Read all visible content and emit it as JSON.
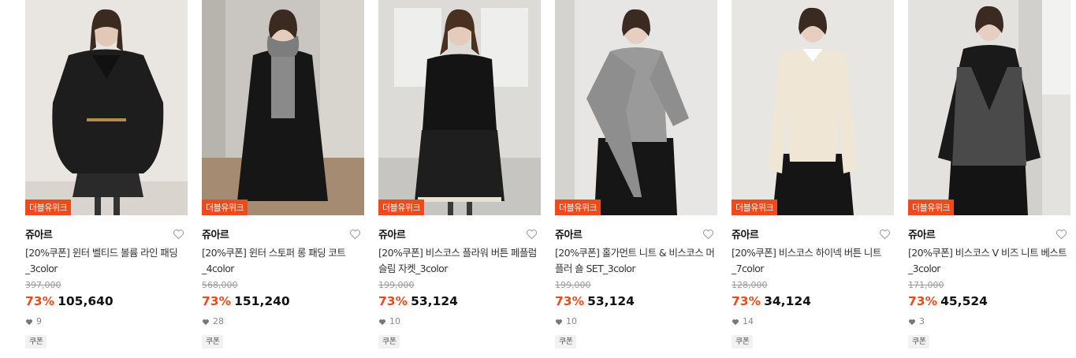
{
  "products": [
    {
      "promo": "더블유위크",
      "brand": "쥬아르",
      "name": "[20%쿠폰] 윈터 벨티드 볼륨 라인 패딩_3color",
      "original_price": "397,000",
      "discount": "73%",
      "price": "105,640",
      "likes": "9",
      "coupon": "쿠폰"
    },
    {
      "promo": "더블유위크",
      "brand": "쥬아르",
      "name": "[20%쿠폰] 윈터 스토퍼 롱 패딩 코트_4color",
      "original_price": "568,000",
      "discount": "73%",
      "price": "151,240",
      "likes": "28",
      "coupon": "쿠폰"
    },
    {
      "promo": "더블유위크",
      "brand": "쥬아르",
      "name": "[20%쿠폰] 비스코스 플라워 버튼 페플럼 슬림 자켓_3color",
      "original_price": "199,000",
      "discount": "73%",
      "price": "53,124",
      "likes": "10",
      "coupon": "쿠폰"
    },
    {
      "promo": "더블유위크",
      "brand": "쥬아르",
      "name": "[20%쿠폰] 홀가먼트 니트 & 비스코스 머플러 숄 SET_3color",
      "original_price": "199,000",
      "discount": "73%",
      "price": "53,124",
      "likes": "10",
      "coupon": "쿠폰"
    },
    {
      "promo": "더블유위크",
      "brand": "쥬아르",
      "name": "[20%쿠폰] 비스코스 하이넥 버튼 니트_7color",
      "original_price": "128,000",
      "discount": "73%",
      "price": "34,124",
      "likes": "14",
      "coupon": "쿠폰"
    },
    {
      "promo": "더블유위크",
      "brand": "쥬아르",
      "name": "[20%쿠폰] 비스코스 V 비즈 니트 베스트_3color",
      "original_price": "171,000",
      "discount": "73%",
      "price": "45,524",
      "likes": "3",
      "coupon": "쿠폰"
    }
  ],
  "colors": {
    "accent": "#f04a1c"
  },
  "icons": {
    "wishlist": "heart-outline-icon",
    "likes": "heart-filled-icon"
  }
}
